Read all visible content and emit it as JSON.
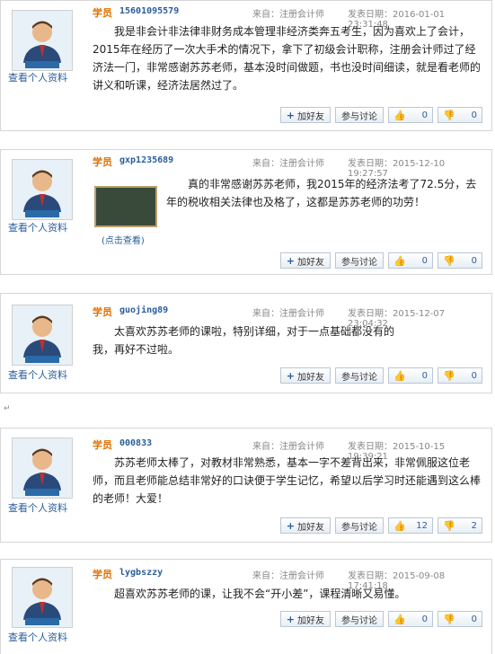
{
  "common": {
    "view_profile": "查看个人资料",
    "role": "学员",
    "source_label": "来自：注册会计师",
    "date_label": "发表日期：",
    "add_friend": "加好友",
    "discuss": "参与讨论",
    "click_view": "(点击查看)"
  },
  "posts": [
    {
      "user": "15601095579",
      "date": "2016-01-01 23:31:48",
      "text": "我是非会计非法律非财务成本管理非经济类奔五考生，因为喜欢上了会计，2015年在经历了一次大手术的情况下，拿下了初级会计职称，注册会计师过了经济法一门，非常感谢苏苏老师，基本没时间做题，书也没时间细读，就是看老师的讲义和听课，经济法居然过了。",
      "likes": "0",
      "dislikes": "0"
    },
    {
      "user": "gxp1235689",
      "date": "2015-12-10 19:27:57",
      "text": "真的非常感谢苏苏老师，我2015年的经济法考了72.5分，去年的税收相关法律也及格了，这都是苏苏老师的功劳！",
      "likes": "0",
      "dislikes": "0"
    },
    {
      "user": "guojing89",
      "date": "2015-12-07 23:04:32",
      "text": "太喜欢苏苏老师的课啦，特别详细，对于一点基础都没有的我，再好不过啦。",
      "likes": "0",
      "dislikes": "0"
    },
    {
      "user": "000833",
      "date": "2015-10-15 19:39:21",
      "text": "苏苏老师太棒了，对教材非常熟悉，基本一字不差背出来，非常佩服这位老师，而且老师能总结非常好的口诀便于学生记忆，希望以后学习时还能遇到这么棒的老师！大爱！",
      "likes": "12",
      "dislikes": "2"
    },
    {
      "user": "lygbszzy",
      "date": "2015-09-08 17:41:18",
      "text": "超喜欢苏苏老师的课，让我不会“开小差”，课程清晰又易懂。",
      "likes": "0",
      "dislikes": "0"
    }
  ]
}
